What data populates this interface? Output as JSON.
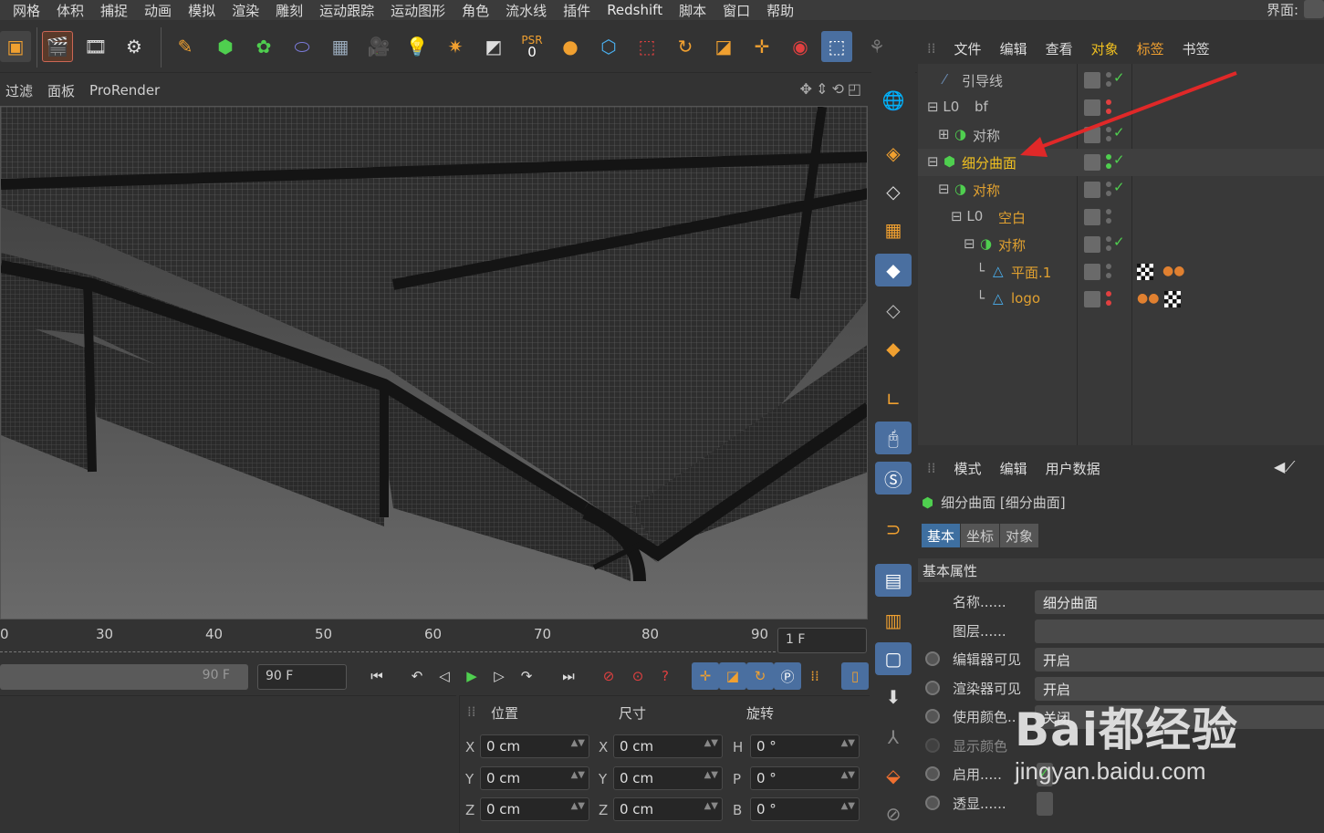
{
  "menu": {
    "items": [
      "网格",
      "体积",
      "捕捉",
      "动画",
      "模拟",
      "渲染",
      "雕刻",
      "运动跟踪",
      "运动图形",
      "角色",
      "流水线",
      "插件",
      "Redshift",
      "脚本",
      "窗口",
      "帮助"
    ],
    "interface_label": "界面:"
  },
  "viewport_menu": {
    "items": [
      "过滤",
      "面板",
      "ProRender"
    ]
  },
  "toolbar": {
    "psr_label": "PSR",
    "psr_value": "0"
  },
  "timeline": {
    "ticks": [
      "0",
      "30",
      "40",
      "50",
      "60",
      "70",
      "80",
      "90"
    ],
    "current_frame": "1 F",
    "slider_end": "90 F",
    "end_frame": "90 F"
  },
  "object_manager": {
    "menu": [
      "文件",
      "编辑",
      "查看",
      "对象",
      "标签",
      "书签"
    ],
    "rows": [
      {
        "name": "引导线",
        "prefix": "",
        "color": "#bdbdbd",
        "dot_top": "#6a6a6a",
        "dot_bot": "#6a6a6a",
        "check": true
      },
      {
        "name": "bf",
        "prefix": "⊟ L0",
        "color": "#bdbdbd",
        "dot_top": "#e04040",
        "dot_bot": "#e04040",
        "check": false
      },
      {
        "name": "对称",
        "prefix": "⊞",
        "color": "#bdbdbd",
        "dot_top": "#6a6a6a",
        "dot_bot": "#6a6a6a",
        "check": true
      },
      {
        "name": "细分曲面",
        "prefix": "⊟",
        "color": "#f0c020",
        "dot_top": "#4fcf4f",
        "dot_bot": "#4fcf4f",
        "check": true
      },
      {
        "name": "对称",
        "prefix": "⊟",
        "color": "#e0a030",
        "dot_top": "#6a6a6a",
        "dot_bot": "#6a6a6a",
        "check": true
      },
      {
        "name": "空白",
        "prefix": "⊟ L0",
        "color": "#e0a030",
        "dot_top": "#6a6a6a",
        "dot_bot": "#6a6a6a",
        "check": false
      },
      {
        "name": "对称",
        "prefix": "⊟",
        "color": "#e0a030",
        "dot_top": "#6a6a6a",
        "dot_bot": "#6a6a6a",
        "check": true
      },
      {
        "name": "平面.1",
        "prefix": "└",
        "color": "#e0a030",
        "dot_top": "#6a6a6a",
        "dot_bot": "#6a6a6a",
        "check": false
      },
      {
        "name": "logo",
        "prefix": "└",
        "color": "#e0a030",
        "dot_top": "#e04040",
        "dot_bot": "#e04040",
        "check": false
      }
    ]
  },
  "attribute_manager": {
    "menu": [
      "模式",
      "编辑",
      "用户数据"
    ],
    "title": "细分曲面 [细分曲面]",
    "tabs": [
      "基本",
      "坐标",
      "对象"
    ],
    "group": "基本属性",
    "rows": [
      {
        "label": "名称......",
        "value": "细分曲面"
      },
      {
        "label": "图层......",
        "value": ""
      },
      {
        "label": "编辑器可见",
        "value": "开启"
      },
      {
        "label": "渲染器可见",
        "value": "开启"
      },
      {
        "label": "使用颜色..",
        "value": "关闭"
      },
      {
        "label": "显示颜色",
        "value": ""
      },
      {
        "label": "启用.....",
        "value": "✓"
      },
      {
        "label": "透显......",
        "value": ""
      }
    ]
  },
  "coordinates": {
    "headers": [
      "位置",
      "尺寸",
      "旋转"
    ],
    "pos": [
      {
        "axis": "X",
        "value": "0 cm"
      },
      {
        "axis": "Y",
        "value": "0 cm"
      },
      {
        "axis": "Z",
        "value": "0 cm"
      }
    ],
    "size": [
      {
        "axis": "X",
        "value": "0 cm"
      },
      {
        "axis": "Y",
        "value": "0 cm"
      },
      {
        "axis": "Z",
        "value": "0 cm"
      }
    ],
    "rot": [
      {
        "axis": "H",
        "value": "0 °"
      },
      {
        "axis": "P",
        "value": "0 °"
      },
      {
        "axis": "B",
        "value": "0 °"
      }
    ]
  },
  "watermark": {
    "main": "Bai都经验",
    "sub": "jingyan.baidu.com"
  },
  "colors": {
    "accent_blue": "#3e6fa0",
    "highlight_yellow": "#f0c020",
    "arrow_red": "#e02828"
  }
}
